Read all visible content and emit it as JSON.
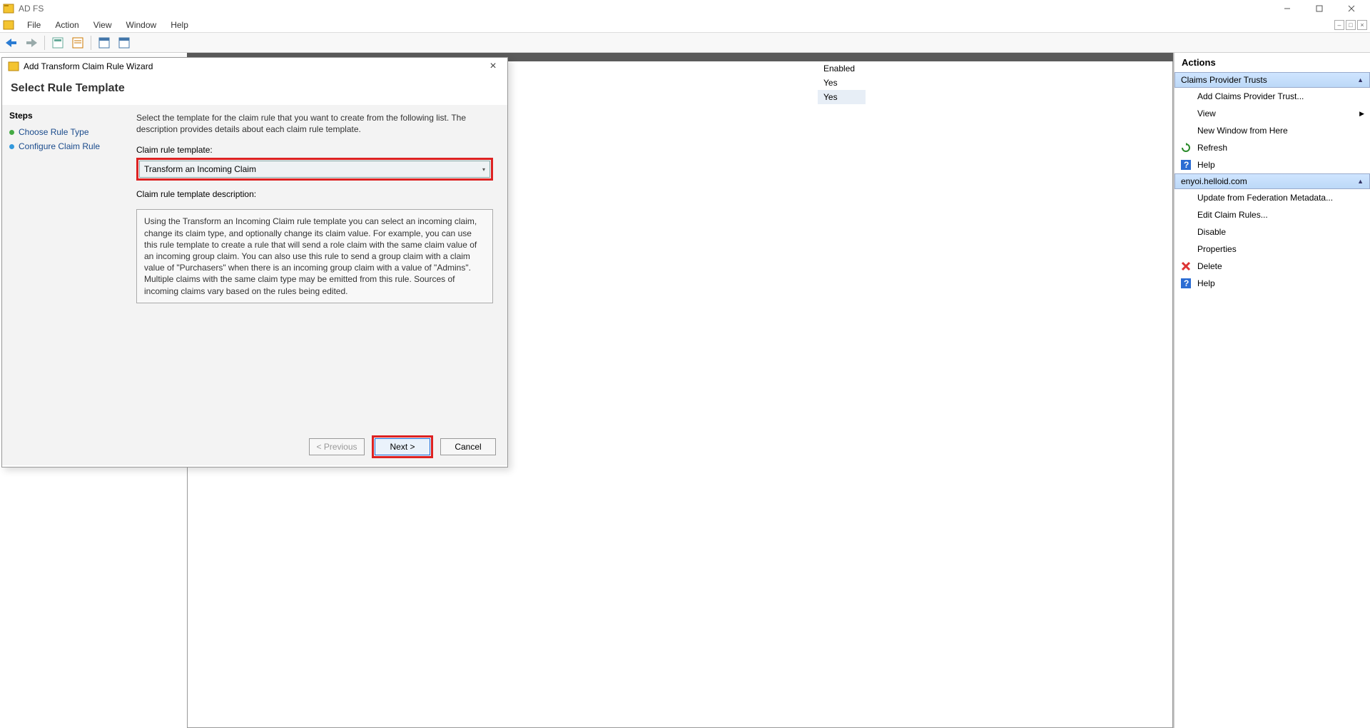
{
  "window": {
    "title": "AD FS"
  },
  "menubar": {
    "items": [
      "File",
      "Action",
      "View",
      "Window",
      "Help"
    ]
  },
  "mainlist": {
    "header": "Enabled",
    "rows": [
      "Yes",
      "Yes"
    ]
  },
  "actions": {
    "title": "Actions",
    "section1": {
      "header": "Claims Provider Trusts",
      "items": [
        {
          "icon": "",
          "label": "Add Claims Provider Trust..."
        },
        {
          "icon": "",
          "label": "View",
          "arrow": true
        },
        {
          "icon": "",
          "label": "New Window from Here"
        },
        {
          "icon": "refresh",
          "label": "Refresh"
        },
        {
          "icon": "help",
          "label": "Help"
        }
      ]
    },
    "section2": {
      "header": "enyoi.helloid.com",
      "items": [
        {
          "icon": "",
          "label": "Update from Federation Metadata..."
        },
        {
          "icon": "",
          "label": "Edit Claim Rules..."
        },
        {
          "icon": "",
          "label": "Disable"
        },
        {
          "icon": "",
          "label": "Properties"
        },
        {
          "icon": "delete",
          "label": "Delete"
        },
        {
          "icon": "help",
          "label": "Help"
        }
      ]
    }
  },
  "wizard": {
    "title": "Add Transform Claim Rule Wizard",
    "header": "Select Rule Template",
    "steps_title": "Steps",
    "steps": [
      {
        "label": "Choose Rule Type",
        "active": true
      },
      {
        "label": "Configure Claim Rule",
        "active": false
      }
    ],
    "instruction": "Select the template for the claim rule that you want to create from the following list. The description provides details about each claim rule template.",
    "combo_label": "Claim rule template:",
    "combo_value": "Transform an Incoming Claim",
    "desc_label": "Claim rule template description:",
    "desc_text": "Using the Transform an Incoming Claim rule template you can select an incoming claim, change its claim type, and optionally change its claim value.  For example, you can use this rule template to create a rule that will send a role claim with the same claim value of an incoming group claim.  You can also use this rule to send a group claim with a claim value of \"Purchasers\" when there is an incoming group claim with a value of \"Admins\".  Multiple claims with the same claim type may be emitted from this rule.  Sources of incoming claims vary based on the rules being edited.",
    "buttons": {
      "previous": "< Previous",
      "next": "Next >",
      "cancel": "Cancel"
    }
  }
}
